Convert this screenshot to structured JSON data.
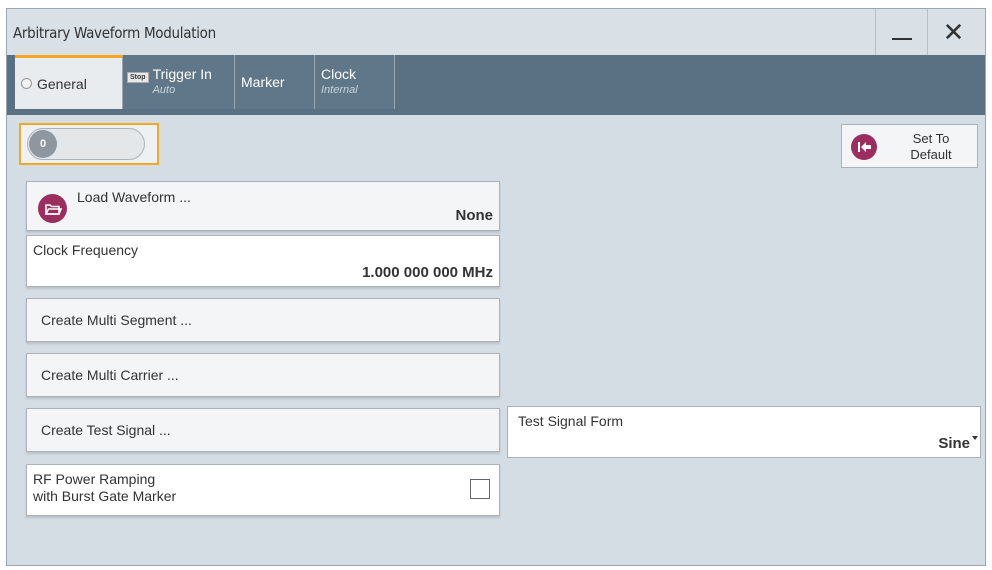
{
  "window": {
    "title": "Arbitrary Waveform Modulation"
  },
  "tabs": [
    {
      "label": "General"
    },
    {
      "badge": "Stop",
      "label": "Trigger In",
      "sub": "Auto"
    },
    {
      "label": "Marker"
    },
    {
      "label": "Clock",
      "sub": "Internal"
    }
  ],
  "state_toggle": {
    "knob": "0"
  },
  "set_default": {
    "label_line1": "Set To",
    "label_line2": "Default"
  },
  "load_waveform": {
    "label": "Load Waveform ...",
    "value": "None"
  },
  "clock_frequency": {
    "label": "Clock Frequency",
    "value": "1.000 000 000 MHz"
  },
  "create_multi_segment": {
    "label": "Create Multi Segment ..."
  },
  "create_multi_carrier": {
    "label": "Create Multi Carrier ..."
  },
  "create_test_signal": {
    "label": "Create Test Signal ..."
  },
  "test_signal_form": {
    "label": "Test Signal Form",
    "value": "Sine"
  },
  "rf_power_ramping": {
    "label_line1": "RF Power Ramping",
    "label_line2": "with Burst Gate Marker",
    "checked": false
  },
  "colors": {
    "accent": "#f5a623",
    "icon_magenta": "#9b2d5f",
    "tabbar": "#5a7184",
    "panel_bg": "#d4dde4"
  }
}
